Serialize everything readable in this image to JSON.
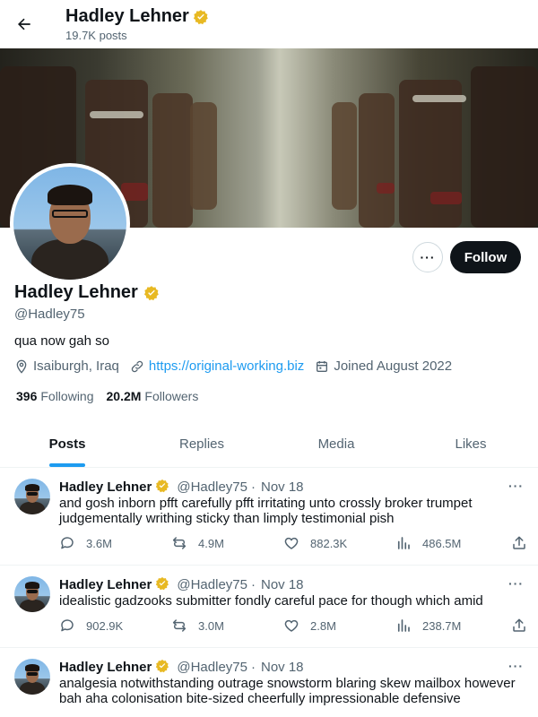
{
  "header": {
    "name": "Hadley Lehner",
    "post_count": "19.7K posts"
  },
  "profile": {
    "name": "Hadley Lehner",
    "handle": "@Hadley75",
    "bio": "qua now gah so",
    "location": "Isaiburgh, Iraq",
    "website": "https://original-working.biz",
    "joined": "Joined August 2022",
    "following_count": "396",
    "following_label": "Following",
    "followers_count": "20.2M",
    "followers_label": "Followers",
    "follow_label": "Follow",
    "more_label": "···"
  },
  "tabs": [
    {
      "label": "Posts",
      "active": true
    },
    {
      "label": "Replies",
      "active": false
    },
    {
      "label": "Media",
      "active": false
    },
    {
      "label": "Likes",
      "active": false
    }
  ],
  "posts": [
    {
      "name": "Hadley Lehner",
      "handle": "@Hadley75",
      "date": "Nov 18",
      "text": "and gosh inborn pfft carefully pfft irritating unto crossly broker trumpet judgementally writhing sticky than limply testimonial pish",
      "replies": "3.6M",
      "reposts": "4.9M",
      "likes": "882.3K",
      "views": "486.5M"
    },
    {
      "name": "Hadley Lehner",
      "handle": "@Hadley75",
      "date": "Nov 18",
      "text": "idealistic gadzooks submitter fondly careful pace for though which amid",
      "replies": "902.9K",
      "reposts": "3.0M",
      "likes": "2.8M",
      "views": "238.7M"
    },
    {
      "name": "Hadley Lehner",
      "handle": "@Hadley75",
      "date": "Nov 18",
      "text": "analgesia notwithstanding outrage snowstorm blaring skew mailbox however bah aha colonisation bite-sized cheerfully impressionable defensive",
      "replies": "",
      "reposts": "",
      "likes": "",
      "views": ""
    }
  ],
  "colors": {
    "accent": "#1d9bf0",
    "verified": "#e8b923",
    "text": "#0f1419",
    "muted": "#536471"
  }
}
